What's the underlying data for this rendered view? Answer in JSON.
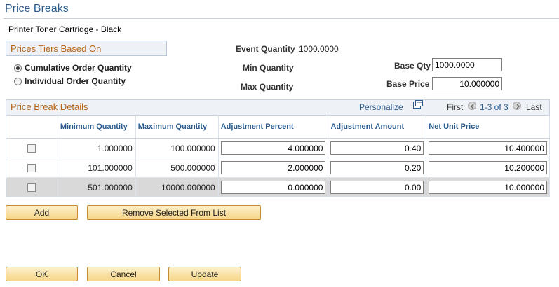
{
  "page": {
    "title": "Price Breaks",
    "item_description": "Printer Toner Cartridge - Black"
  },
  "tiers": {
    "heading": "Prices Tiers Based On",
    "options": [
      {
        "label": "Cumulative Order Quantity",
        "selected": true
      },
      {
        "label": "Individual Order Quantity",
        "selected": false
      }
    ]
  },
  "quantities": {
    "event_quantity_label": "Event Quantity",
    "event_quantity_value": "1000.0000",
    "min_quantity_label": "Min Quantity",
    "max_quantity_label": "Max Quantity",
    "base_qty_label": "Base Qty",
    "base_qty_value": "1000.0000",
    "base_price_label": "Base Price",
    "base_price_value": "10.000000"
  },
  "grid": {
    "title": "Price Break Details",
    "personalize": "Personalize",
    "nav_first": "First",
    "nav_range": "1-3 of 3",
    "nav_last": "Last",
    "columns": [
      "",
      "Minimum Quantity",
      "Maximum Quantity",
      "Adjustment Percent",
      "Adjustment Amount",
      "Net Unit Price"
    ],
    "rows": [
      {
        "min": "1.000000",
        "max": "100.000000",
        "adj_pct": "4.000000",
        "adj_amt": "0.40",
        "net": "10.400000"
      },
      {
        "min": "101.000000",
        "max": "500.000000",
        "adj_pct": "2.000000",
        "adj_amt": "0.20",
        "net": "10.200000"
      },
      {
        "min": "501.000000",
        "max": "10000.000000",
        "adj_pct": "0.000000",
        "adj_amt": "0.00",
        "net": "10.000000"
      }
    ]
  },
  "buttons": {
    "add": "Add",
    "remove": "Remove Selected From List",
    "ok": "OK",
    "cancel": "Cancel",
    "update": "Update"
  },
  "colors": {
    "accent_blue": "#2b5a8b",
    "section_orange": "#b5651d",
    "button_border": "#c68c2d"
  }
}
